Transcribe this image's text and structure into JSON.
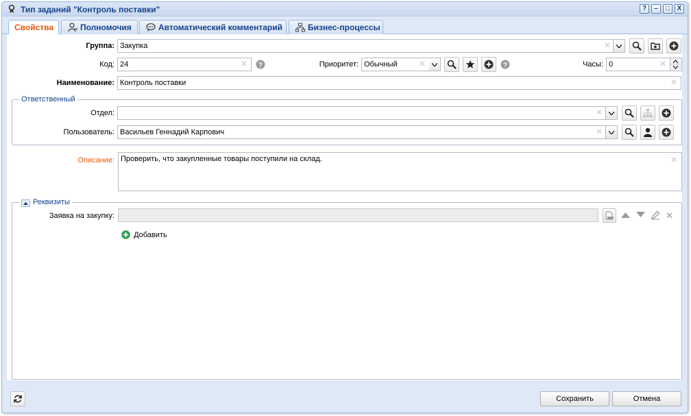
{
  "window": {
    "title": "Тип заданий \"Контроль поставки\"",
    "controls": {
      "help": "?",
      "minimize": "–",
      "maximize": "□",
      "close": "X"
    }
  },
  "tabs": [
    {
      "label": "Свойства",
      "active": true
    },
    {
      "label": "Полномочия",
      "icon": "user-key-icon"
    },
    {
      "label": "Автоматический комментарий",
      "icon": "speech-bubble-icon"
    },
    {
      "label": "Бизнес-процессы",
      "icon": "org-chart-icon"
    }
  ],
  "form": {
    "group": {
      "label": "Группа:",
      "value": "Закупка"
    },
    "code": {
      "label": "Код:",
      "value": "24"
    },
    "priority": {
      "label": "Приоритет:",
      "value": "Обычный"
    },
    "hours": {
      "label": "Часы:",
      "value": "0"
    },
    "name": {
      "label": "Наименование:",
      "value": "Контроль поставки"
    }
  },
  "responsible": {
    "legend": "Ответственный",
    "department": {
      "label": "Отдел:",
      "value": ""
    },
    "user": {
      "label": "Пользователь:",
      "value": "Васильев Геннадий Карпович"
    }
  },
  "description": {
    "label": "Описание:",
    "value": "Проверить, что закупленные товары поступили на склад."
  },
  "requisites": {
    "legend": "Реквизиты",
    "purchase_request": {
      "label": "Заявка на закупку:",
      "value": ""
    },
    "add_label": "Добавить"
  },
  "footer": {
    "save_label": "Сохранить",
    "cancel_label": "Отмена"
  },
  "colors": {
    "accent": "#e05a10",
    "title": "#15428b",
    "border": "#99bbe8"
  }
}
